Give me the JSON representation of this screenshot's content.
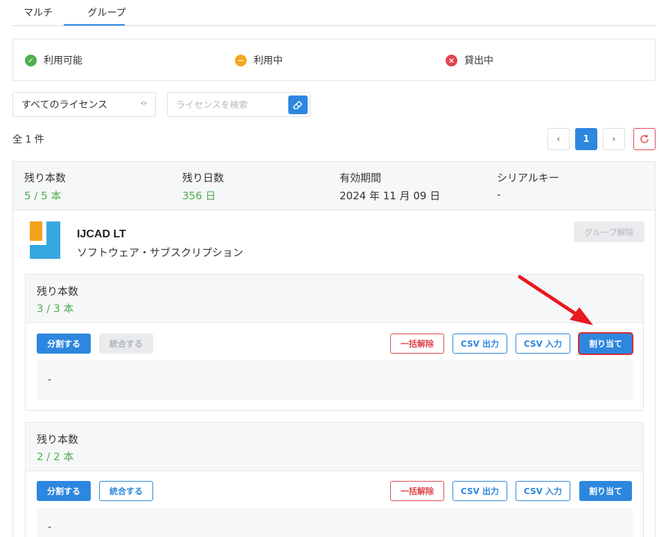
{
  "tabs": [
    {
      "label": "マルチ",
      "active": false
    },
    {
      "label": "グループ",
      "active": true
    }
  ],
  "legend": [
    {
      "label": "利用可能",
      "icon": "check-circle-icon",
      "color": "#4cae4f"
    },
    {
      "label": "利用中",
      "icon": "minus-circle-icon",
      "color": "#f5a623"
    },
    {
      "label": "貸出中",
      "icon": "x-circle-icon",
      "color": "#e0474e"
    }
  ],
  "filter": {
    "selected": "すべてのライセンス"
  },
  "search": {
    "placeholder": "ライセンスを検索",
    "value": ""
  },
  "total_label": "全 1 件",
  "pagination": {
    "current": "1",
    "prev": "‹",
    "next": "›"
  },
  "license": {
    "stats": [
      {
        "label": "残り本数",
        "value": "5 / 5 本",
        "green": true
      },
      {
        "label": "残り日数",
        "value": "356 日",
        "green": true
      },
      {
        "label": "有効期間",
        "value": "2024 年 11 月 09 日",
        "green": false
      },
      {
        "label": "シリアルキー",
        "value": "-",
        "green": false
      }
    ],
    "product_name": "IJCAD LT",
    "product_type": "ソフトウェア・サブスクリプション",
    "ungroup_label": "グループ解除"
  },
  "groups": [
    {
      "remaining_label": "残り本数",
      "remaining_value": "3 / 3 本",
      "split_label": "分割する",
      "merge_label": "統合する",
      "merge_enabled": false,
      "bulk_release_label": "一括解除",
      "csv_out_label": "CSV 出力",
      "csv_in_label": "CSV 入力",
      "assign_label": "割り当て",
      "members_text": "-"
    },
    {
      "remaining_label": "残り本数",
      "remaining_value": "2 / 2 本",
      "split_label": "分割する",
      "merge_label": "統合する",
      "merge_enabled": true,
      "bulk_release_label": "一括解除",
      "csv_out_label": "CSV 出力",
      "csv_in_label": "CSV 入力",
      "assign_label": "割り当て",
      "members_text": "-"
    }
  ],
  "colors": {
    "accent": "#2d87de",
    "success": "#4cae4f",
    "danger": "#e0474e",
    "warning": "#f5a623"
  }
}
